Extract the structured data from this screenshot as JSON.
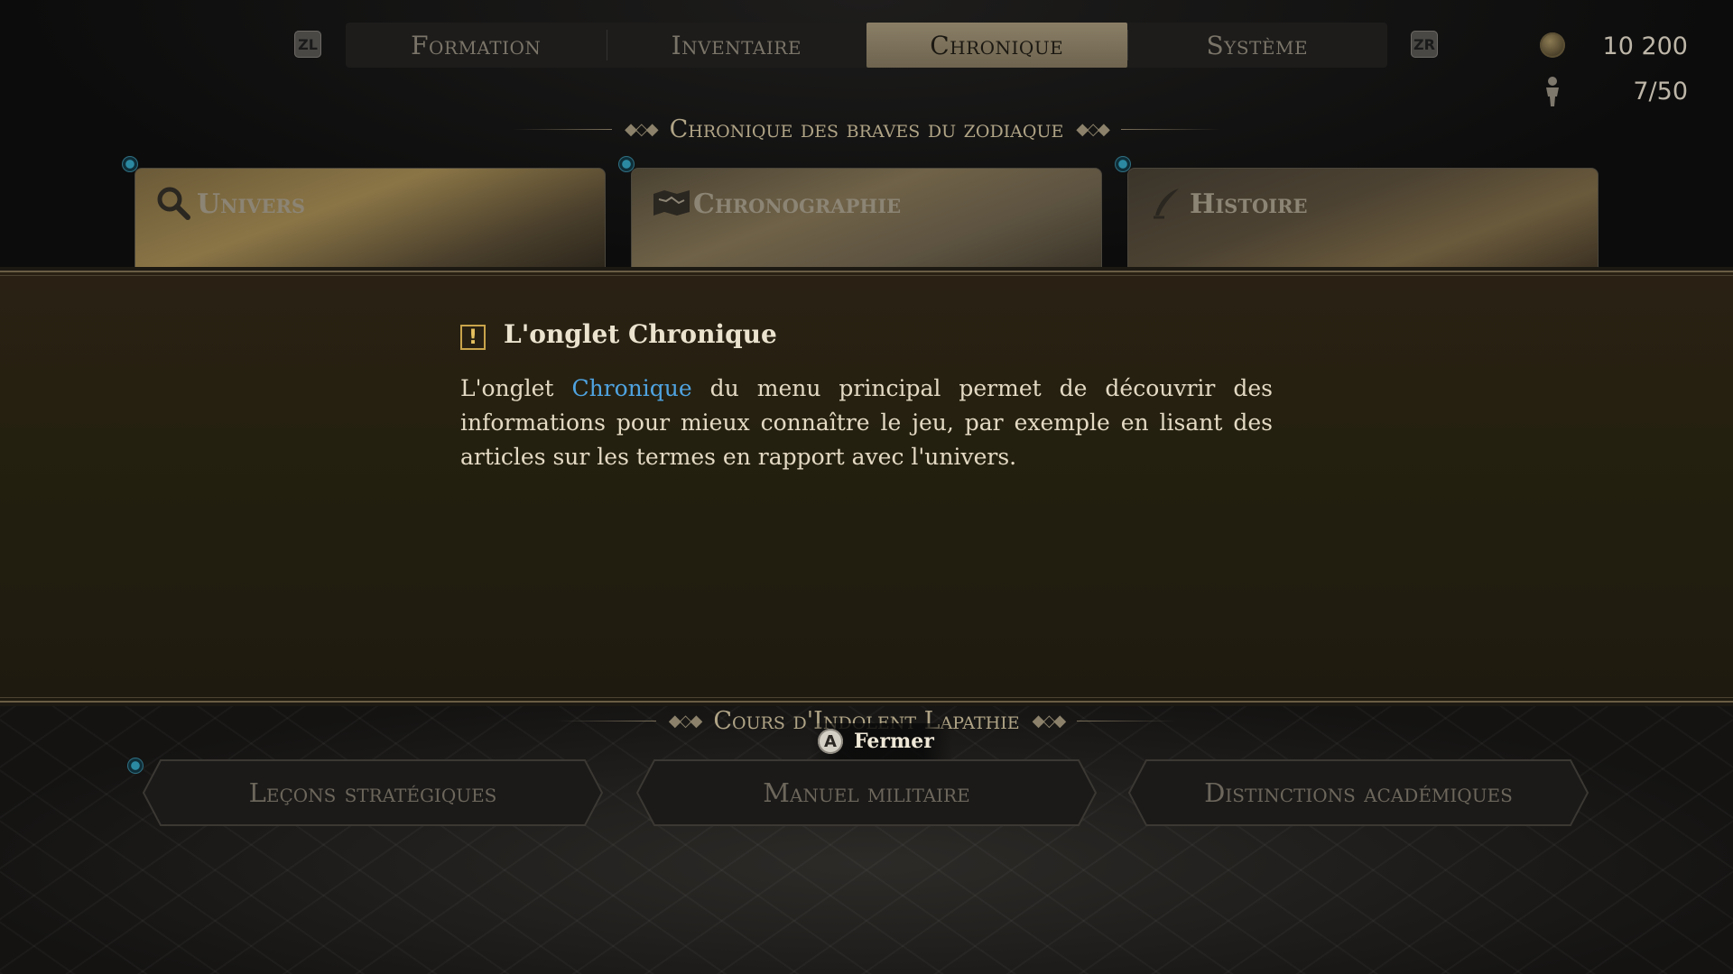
{
  "top_nav": {
    "left_shoulder": "ZL",
    "right_shoulder": "ZR",
    "tabs": [
      {
        "label": "Formation",
        "active": false
      },
      {
        "label": "Inventaire",
        "active": false
      },
      {
        "label": "Chronique",
        "active": true
      },
      {
        "label": "Système",
        "active": false
      }
    ]
  },
  "stats": {
    "money": "10 200",
    "party": "7/50"
  },
  "chronicle_section": {
    "title": "Chronique des braves du zodiaque",
    "cards": [
      {
        "label": "Univers",
        "icon": "magnifier-icon"
      },
      {
        "label": "Chronographie",
        "icon": "map-icon"
      },
      {
        "label": "Histoire",
        "icon": "quill-icon"
      }
    ]
  },
  "dialog": {
    "title": "L'onglet Chronique",
    "body_before": "L'onglet ",
    "body_highlight": "Chronique",
    "body_after": " du menu principal permet de découvrir des informations pour mieux connaître le jeu, par exemple en lisant des articles sur les termes en rapport avec l'univers."
  },
  "course_section": {
    "title": "Cours d'Indolent Lapathie",
    "buttons": [
      "Leçons stratégiques",
      "Manuel militaire",
      "Distinctions académiques"
    ]
  },
  "close_prompt": {
    "button": "A",
    "label": "Fermer"
  },
  "colors": {
    "highlight": "#4fa3e0",
    "active_tab": "#8a7e66",
    "dialog_bg": "#24200f"
  }
}
